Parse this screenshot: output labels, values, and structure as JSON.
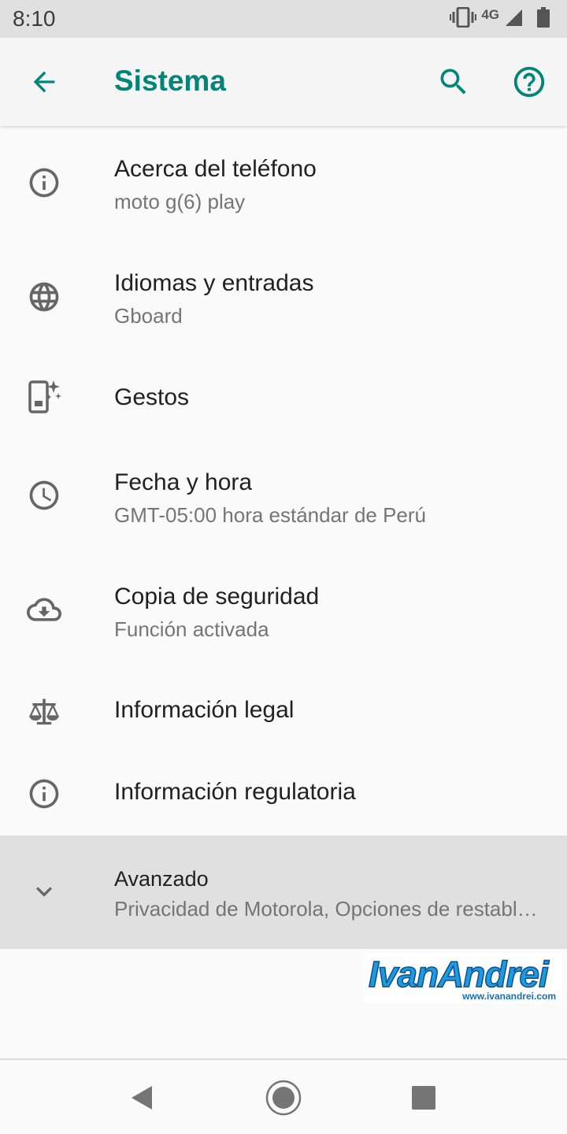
{
  "status_bar": {
    "time": "8:10",
    "network": "4G",
    "icons": [
      "vibrate-icon",
      "signal-icon",
      "battery-icon"
    ]
  },
  "app_bar": {
    "title": "Sistema",
    "back_icon": "arrow-back-icon",
    "search_icon": "search-icon",
    "help_icon": "help-icon",
    "accent_color": "#008577"
  },
  "items": [
    {
      "icon": "info-icon",
      "label": "Acerca del teléfono",
      "summary": "moto g(6) play"
    },
    {
      "icon": "globe-icon",
      "label": "Idiomas y entradas",
      "summary": "Gboard"
    },
    {
      "icon": "gestures-icon",
      "label": "Gestos",
      "summary": ""
    },
    {
      "icon": "clock-icon",
      "label": "Fecha y hora",
      "summary": "GMT-05:00 hora estándar de Perú"
    },
    {
      "icon": "cloud-backup-icon",
      "label": "Copia de seguridad",
      "summary": "Función activada"
    },
    {
      "icon": "scale-icon",
      "label": "Información legal",
      "summary": ""
    },
    {
      "icon": "info-icon",
      "label": "Información regulatoria",
      "summary": ""
    },
    {
      "icon": "chevron-down-icon",
      "label": "Avanzado",
      "summary": "Privacidad de Motorola, Opciones de restablecimiento"
    }
  ],
  "watermark": {
    "brand": "IvanAndrei",
    "url": "www.ivanandrei.com"
  },
  "nav_bar": {
    "icons": [
      "nav-back-icon",
      "nav-home-icon",
      "nav-recents-icon"
    ]
  }
}
